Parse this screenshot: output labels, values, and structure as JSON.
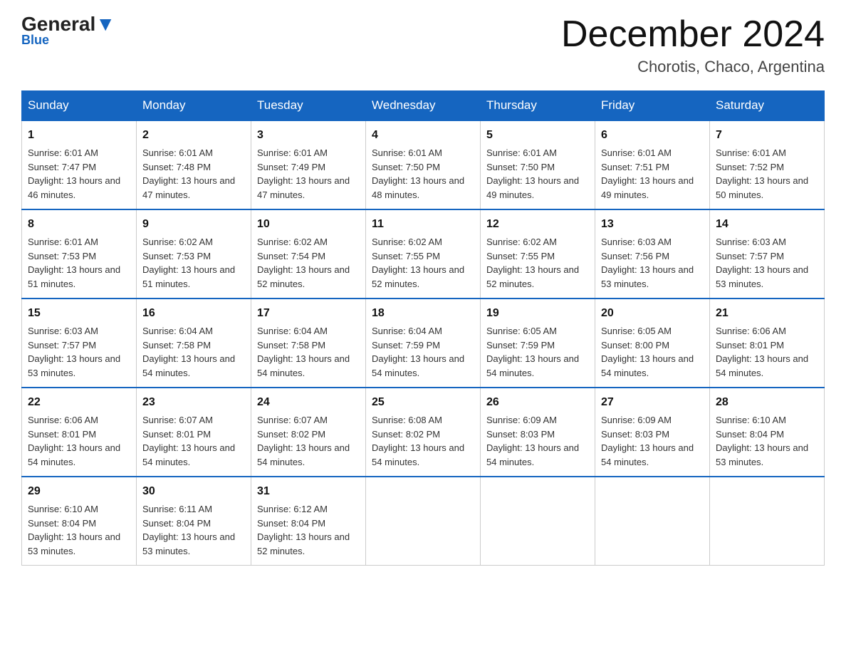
{
  "header": {
    "logo_general": "General",
    "logo_blue": "Blue",
    "month_title": "December 2024",
    "location": "Chorotis, Chaco, Argentina"
  },
  "days_of_week": [
    "Sunday",
    "Monday",
    "Tuesday",
    "Wednesday",
    "Thursday",
    "Friday",
    "Saturday"
  ],
  "weeks": [
    [
      {
        "num": "1",
        "sunrise": "6:01 AM",
        "sunset": "7:47 PM",
        "daylight": "13 hours and 46 minutes."
      },
      {
        "num": "2",
        "sunrise": "6:01 AM",
        "sunset": "7:48 PM",
        "daylight": "13 hours and 47 minutes."
      },
      {
        "num": "3",
        "sunrise": "6:01 AM",
        "sunset": "7:49 PM",
        "daylight": "13 hours and 47 minutes."
      },
      {
        "num": "4",
        "sunrise": "6:01 AM",
        "sunset": "7:50 PM",
        "daylight": "13 hours and 48 minutes."
      },
      {
        "num": "5",
        "sunrise": "6:01 AM",
        "sunset": "7:50 PM",
        "daylight": "13 hours and 49 minutes."
      },
      {
        "num": "6",
        "sunrise": "6:01 AM",
        "sunset": "7:51 PM",
        "daylight": "13 hours and 49 minutes."
      },
      {
        "num": "7",
        "sunrise": "6:01 AM",
        "sunset": "7:52 PM",
        "daylight": "13 hours and 50 minutes."
      }
    ],
    [
      {
        "num": "8",
        "sunrise": "6:01 AM",
        "sunset": "7:53 PM",
        "daylight": "13 hours and 51 minutes."
      },
      {
        "num": "9",
        "sunrise": "6:02 AM",
        "sunset": "7:53 PM",
        "daylight": "13 hours and 51 minutes."
      },
      {
        "num": "10",
        "sunrise": "6:02 AM",
        "sunset": "7:54 PM",
        "daylight": "13 hours and 52 minutes."
      },
      {
        "num": "11",
        "sunrise": "6:02 AM",
        "sunset": "7:55 PM",
        "daylight": "13 hours and 52 minutes."
      },
      {
        "num": "12",
        "sunrise": "6:02 AM",
        "sunset": "7:55 PM",
        "daylight": "13 hours and 52 minutes."
      },
      {
        "num": "13",
        "sunrise": "6:03 AM",
        "sunset": "7:56 PM",
        "daylight": "13 hours and 53 minutes."
      },
      {
        "num": "14",
        "sunrise": "6:03 AM",
        "sunset": "7:57 PM",
        "daylight": "13 hours and 53 minutes."
      }
    ],
    [
      {
        "num": "15",
        "sunrise": "6:03 AM",
        "sunset": "7:57 PM",
        "daylight": "13 hours and 53 minutes."
      },
      {
        "num": "16",
        "sunrise": "6:04 AM",
        "sunset": "7:58 PM",
        "daylight": "13 hours and 54 minutes."
      },
      {
        "num": "17",
        "sunrise": "6:04 AM",
        "sunset": "7:58 PM",
        "daylight": "13 hours and 54 minutes."
      },
      {
        "num": "18",
        "sunrise": "6:04 AM",
        "sunset": "7:59 PM",
        "daylight": "13 hours and 54 minutes."
      },
      {
        "num": "19",
        "sunrise": "6:05 AM",
        "sunset": "7:59 PM",
        "daylight": "13 hours and 54 minutes."
      },
      {
        "num": "20",
        "sunrise": "6:05 AM",
        "sunset": "8:00 PM",
        "daylight": "13 hours and 54 minutes."
      },
      {
        "num": "21",
        "sunrise": "6:06 AM",
        "sunset": "8:01 PM",
        "daylight": "13 hours and 54 minutes."
      }
    ],
    [
      {
        "num": "22",
        "sunrise": "6:06 AM",
        "sunset": "8:01 PM",
        "daylight": "13 hours and 54 minutes."
      },
      {
        "num": "23",
        "sunrise": "6:07 AM",
        "sunset": "8:01 PM",
        "daylight": "13 hours and 54 minutes."
      },
      {
        "num": "24",
        "sunrise": "6:07 AM",
        "sunset": "8:02 PM",
        "daylight": "13 hours and 54 minutes."
      },
      {
        "num": "25",
        "sunrise": "6:08 AM",
        "sunset": "8:02 PM",
        "daylight": "13 hours and 54 minutes."
      },
      {
        "num": "26",
        "sunrise": "6:09 AM",
        "sunset": "8:03 PM",
        "daylight": "13 hours and 54 minutes."
      },
      {
        "num": "27",
        "sunrise": "6:09 AM",
        "sunset": "8:03 PM",
        "daylight": "13 hours and 54 minutes."
      },
      {
        "num": "28",
        "sunrise": "6:10 AM",
        "sunset": "8:04 PM",
        "daylight": "13 hours and 53 minutes."
      }
    ],
    [
      {
        "num": "29",
        "sunrise": "6:10 AM",
        "sunset": "8:04 PM",
        "daylight": "13 hours and 53 minutes."
      },
      {
        "num": "30",
        "sunrise": "6:11 AM",
        "sunset": "8:04 PM",
        "daylight": "13 hours and 53 minutes."
      },
      {
        "num": "31",
        "sunrise": "6:12 AM",
        "sunset": "8:04 PM",
        "daylight": "13 hours and 52 minutes."
      },
      null,
      null,
      null,
      null
    ]
  ]
}
